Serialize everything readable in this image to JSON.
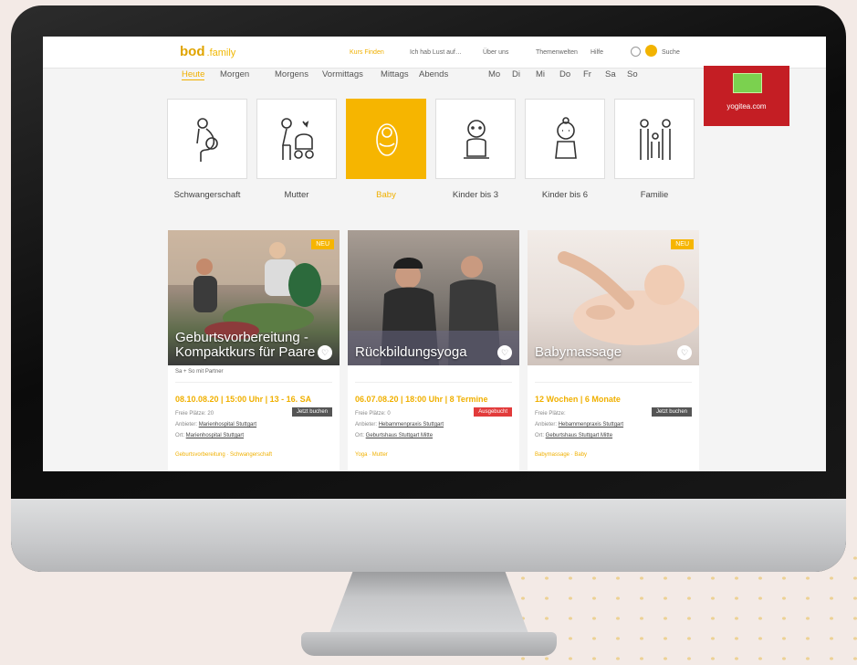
{
  "brand": {
    "name": "bod",
    "suffix": "family"
  },
  "nav": {
    "items": [
      "Kurs Finden",
      "Ich hab Lust auf…",
      "Über uns",
      "Themenwelten",
      "Hilfe"
    ],
    "active": "Kurs Finden",
    "search_label": "Suche"
  },
  "time_filters": [
    "Heute",
    "Morgen",
    "Morgens",
    "Vormittags",
    "Mittags",
    "Abends",
    "Mo",
    "Di",
    "Mi",
    "Do",
    "Fr",
    "Sa",
    "So"
  ],
  "categories": [
    {
      "label": "Schwangerschaft",
      "icon": "pregnancy-icon"
    },
    {
      "label": "Mutter",
      "icon": "mother-stroller-icon"
    },
    {
      "label": "Baby",
      "icon": "baby-icon",
      "selected": true
    },
    {
      "label": "Kinder bis 3",
      "icon": "toddler-icon"
    },
    {
      "label": "Kinder bis 6",
      "icon": "child-icon"
    },
    {
      "label": "Familie",
      "icon": "family-icon"
    }
  ],
  "ad": {
    "text": "yogitea.com",
    "accent": "#c41e24"
  },
  "cards": [
    {
      "title": "Geburtsvorbereitung - Kompaktkurs für Paare",
      "badge_new": "NEU",
      "subtitle": "Sa + So mit Partner",
      "meta": "08.10.08.20 | 15:00 Uhr | 13 - 16. SA",
      "row1_label": "Freie Plätze:",
      "row1_value": "20",
      "row2_label": "Anbieter:",
      "row2_value": "Marienhospital Stuttgart",
      "row3_label": "Ort:",
      "row3_value": "Marienhospital Stuttgart",
      "status": "Jetzt buchen",
      "status_color": "#555555",
      "footer": "Geburtsvorbereitung · Schwangerschaft"
    },
    {
      "title": "Rückbildungsyoga",
      "badge_new": "",
      "subtitle": "",
      "meta": "06.07.08.20 | 18:00 Uhr | 8 Termine",
      "row1_label": "Freie Plätze:",
      "row1_value": "0",
      "row2_label": "Anbieter:",
      "row2_value": "Hebammenpraxis Stuttgart",
      "row3_label": "Ort:",
      "row3_value": "Geburtshaus Stuttgart Mitte",
      "status": "Ausgebucht",
      "status_color": "#e23b3b",
      "footer": "Yoga · Mutter"
    },
    {
      "title": "Babymassage",
      "badge_new": "NEU",
      "subtitle": "",
      "meta": "12 Wochen | 6 Monate",
      "row1_label": "Freie Plätze:",
      "row1_value": "",
      "row2_label": "Anbieter:",
      "row2_value": "Hebammenpraxis Stuttgart",
      "row3_label": "Ort:",
      "row3_value": "Geburtshaus Stuttgart Mitte",
      "status": "Jetzt buchen",
      "status_color": "#555555",
      "footer": "Babymassage · Baby"
    }
  ],
  "colors": {
    "brand_yellow": "#f6b500",
    "ad_red": "#c41e24"
  }
}
